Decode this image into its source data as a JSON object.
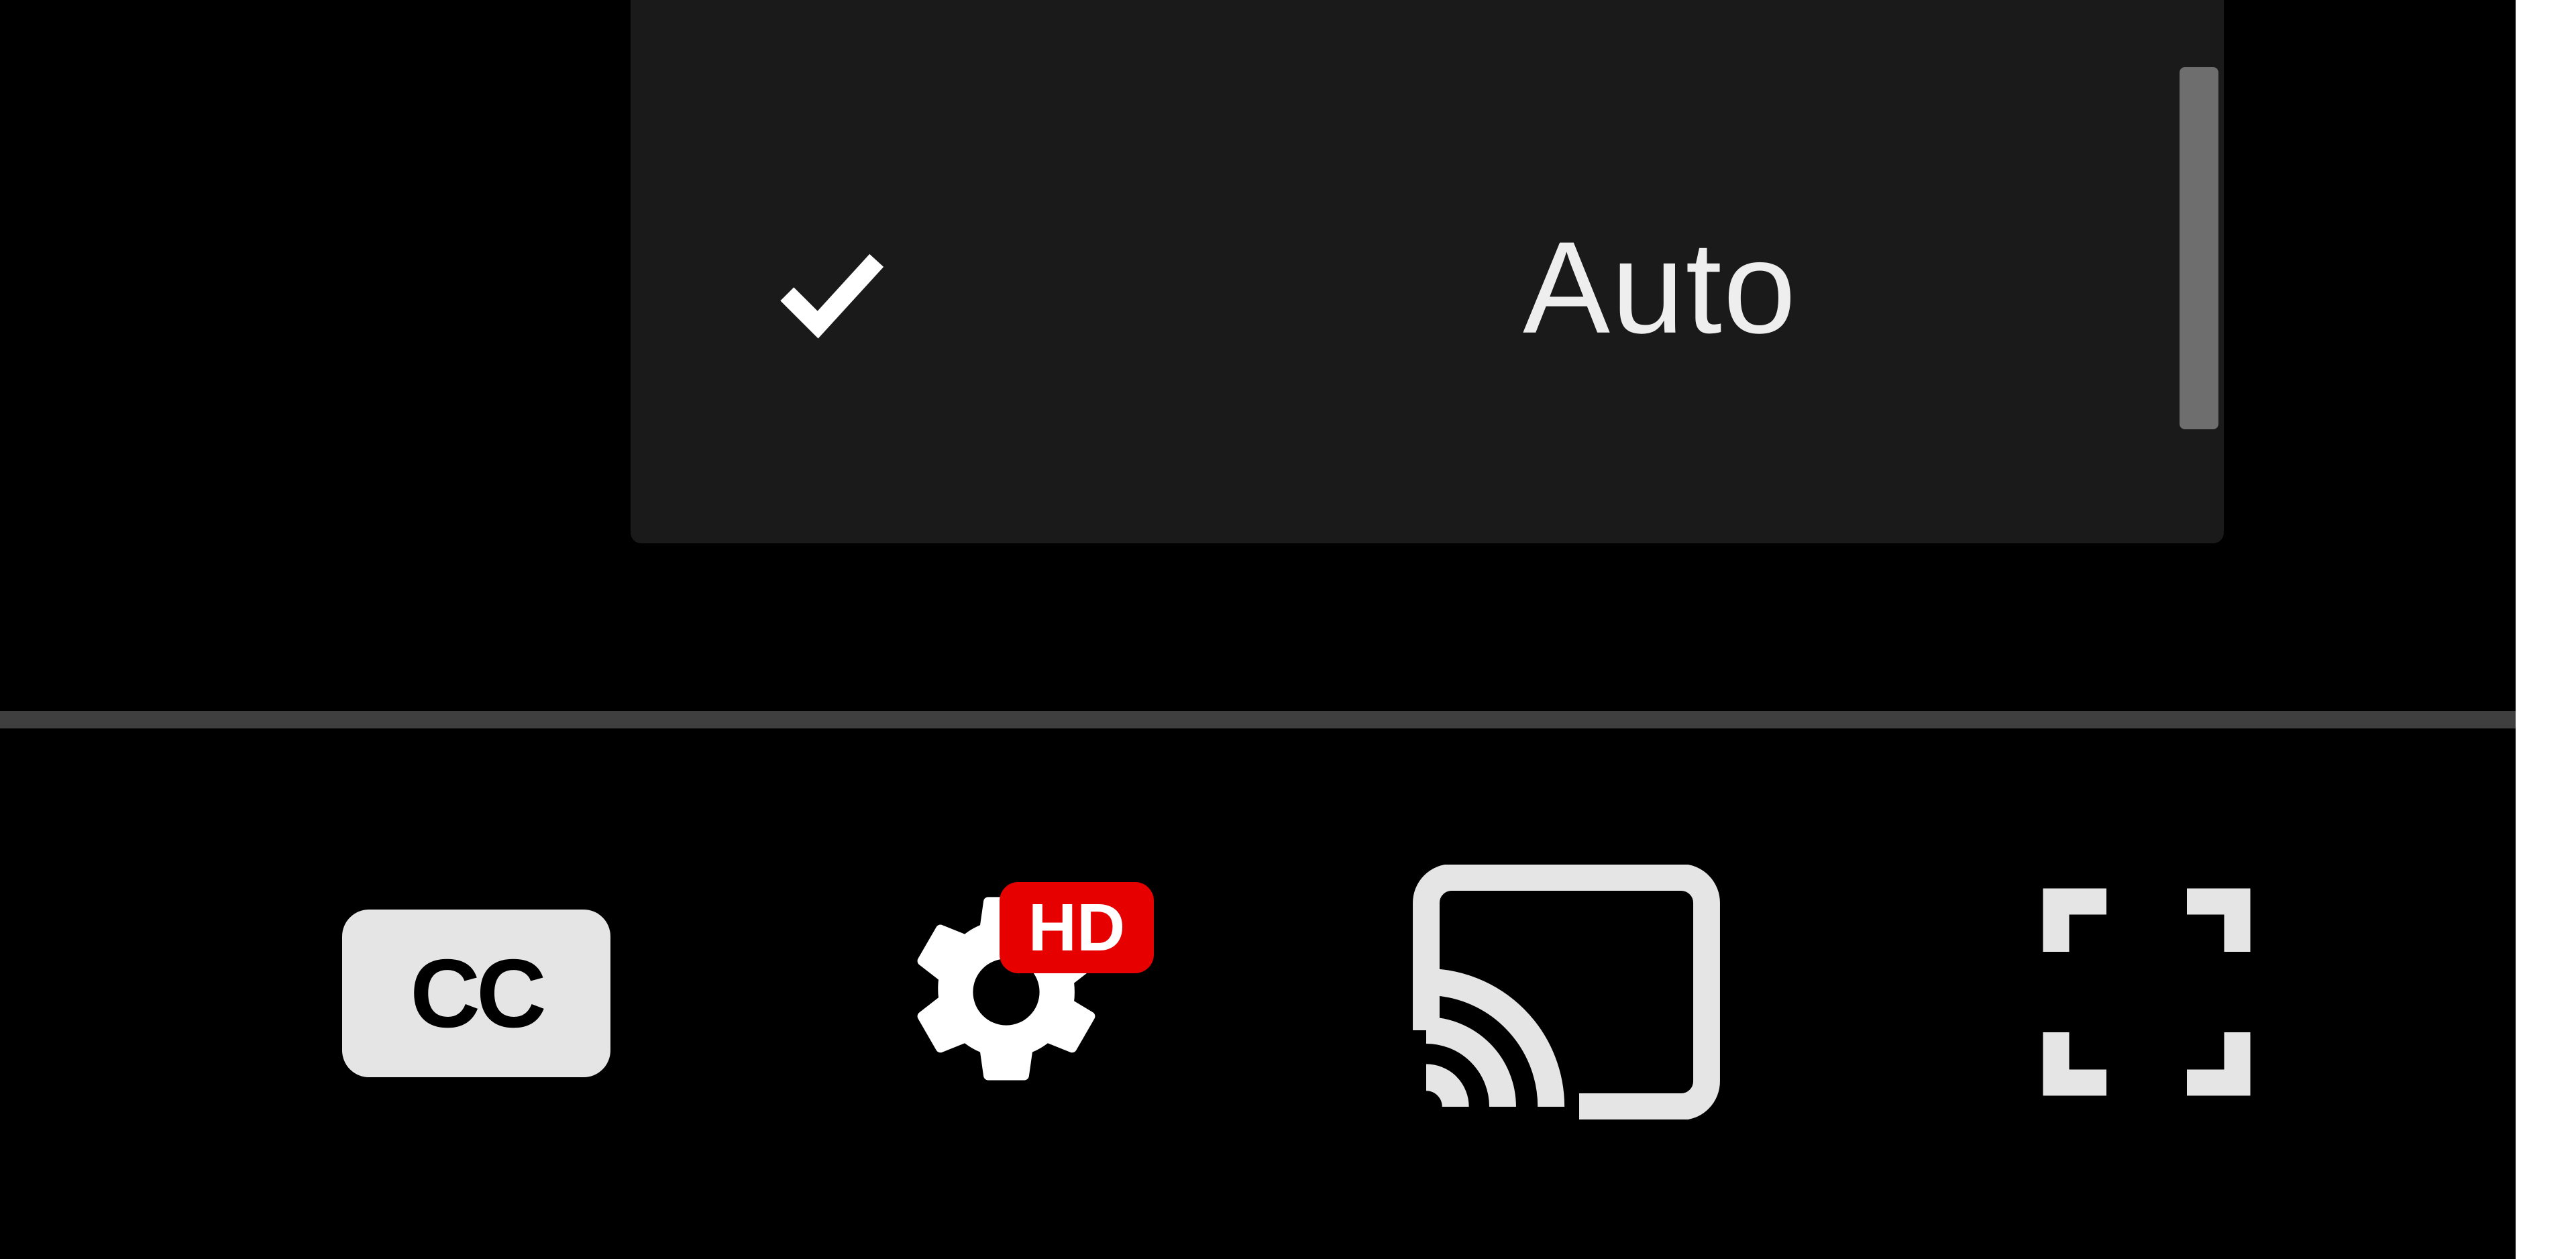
{
  "menu": {
    "selected_label": "Auto"
  },
  "controls": {
    "cc_label": "CC",
    "hd_badge": "HD"
  }
}
